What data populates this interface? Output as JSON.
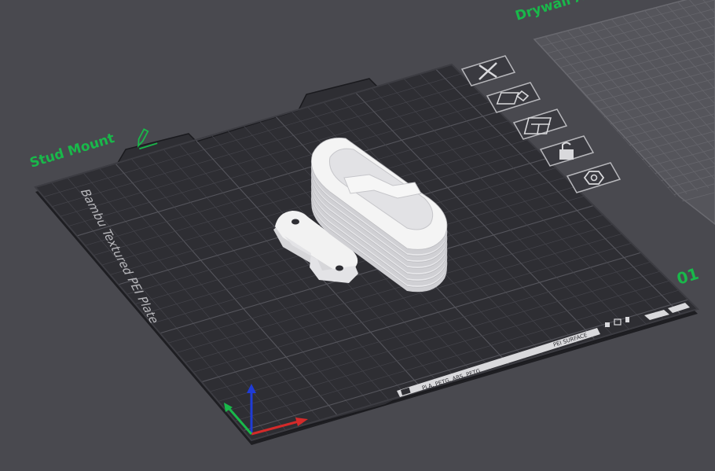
{
  "plates": {
    "current": {
      "name": "Stud Mount",
      "edit_icon": "pencil-icon",
      "surface_label": "Bambu Textured PEI Plate",
      "material_strip": "PLA, PETG, ABS, PETG",
      "surface_strip": "PEI SURFACE",
      "plate_number": "01"
    },
    "next": {
      "name": "Drywall A"
    }
  },
  "plate_toolbar": {
    "items": [
      {
        "icon": "close-icon"
      },
      {
        "icon": "pick-plate-icon"
      },
      {
        "icon": "arrange-icon"
      },
      {
        "icon": "lock-icon"
      },
      {
        "icon": "settings-icon"
      }
    ]
  },
  "colors": {
    "background": "#49494f",
    "plate": "#2e2e33",
    "plate_edge": "#1e1e22",
    "grid": "#4a4a52",
    "accent": "#19b84a",
    "model": "#f2f2f2",
    "axis_x": "#d42a2a",
    "axis_y": "#19b84a",
    "axis_z": "#1f3bd6"
  }
}
